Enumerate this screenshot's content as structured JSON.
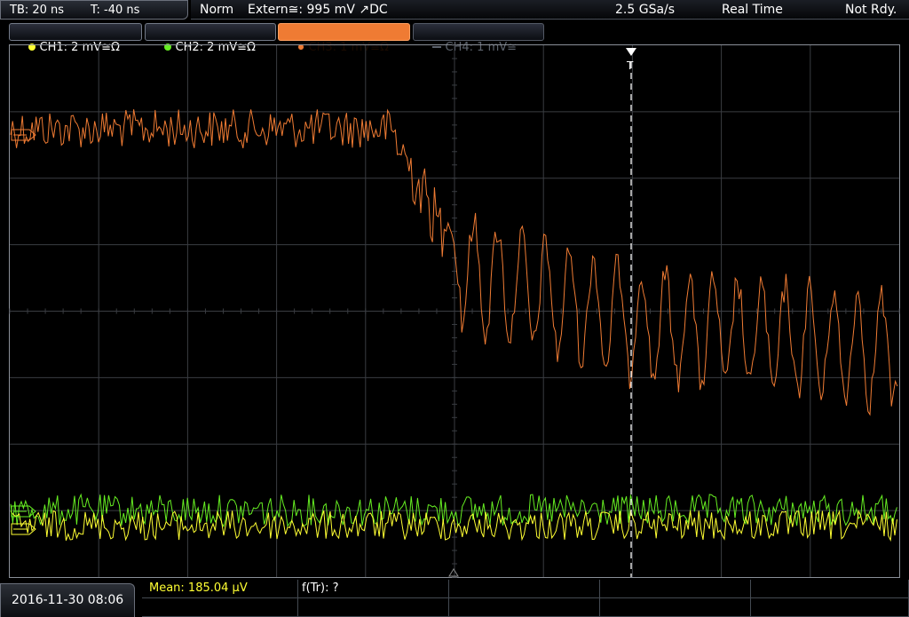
{
  "top": {
    "timebase": "TB: 20 ns",
    "trigger_time": "T: -40 ns",
    "mode": "Norm",
    "trigger_source": "Extern≅: 995 mV ↗DC",
    "sample_rate": "2.5 GSa/s",
    "acquisition": "Real Time",
    "status": "Not Rdy."
  },
  "channels": [
    {
      "label": "CH1: 2 mV≅Ω",
      "color": "#ffff33",
      "state": "on"
    },
    {
      "label": "CH2: 2 mV≅Ω",
      "color": "#66ee22",
      "state": "on"
    },
    {
      "label": "CH3: 1 mV≅Ω",
      "color": "#ef7b33",
      "state": "active"
    },
    {
      "label": "CH4: 1 mV≅",
      "color": "#5d636d",
      "state": "off"
    }
  ],
  "trigger_marker": "T",
  "bottom": {
    "datetime": "2016-11-30 08:06",
    "mean": "Mean: 185.04 µV",
    "frequency": "f(Tr): ?"
  },
  "colors": {
    "ch1": "#ffff33",
    "ch2": "#66ee22",
    "ch3": "#ef7b33",
    "grid": "#3a3d42"
  }
}
